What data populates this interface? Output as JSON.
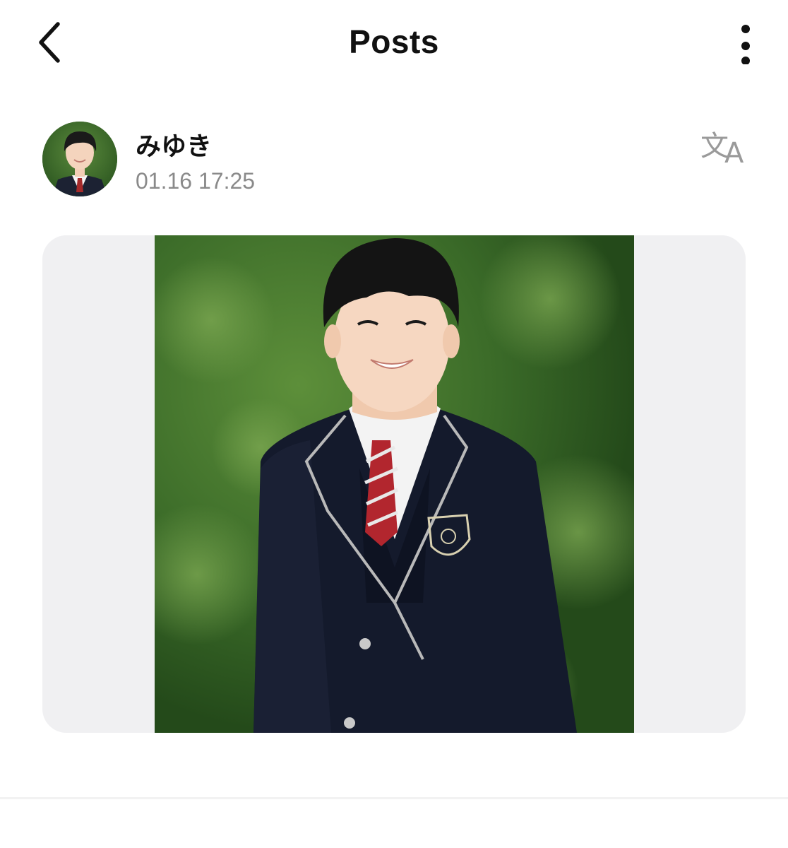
{
  "header": {
    "title": "Posts",
    "back_icon": "chevron-left-icon",
    "more_icon": "vertical-ellipsis-icon"
  },
  "post": {
    "author_name": "みゆき",
    "timestamp": "01.16 17:25",
    "translate_icon": "translate-icon",
    "translate_glyph": "文",
    "translate_glyph_latin": "A"
  },
  "colors": {
    "text_primary": "#111111",
    "text_secondary": "#8a8a8a",
    "card_background": "#f0f0f2",
    "photo_background": "#3c6a2a"
  }
}
